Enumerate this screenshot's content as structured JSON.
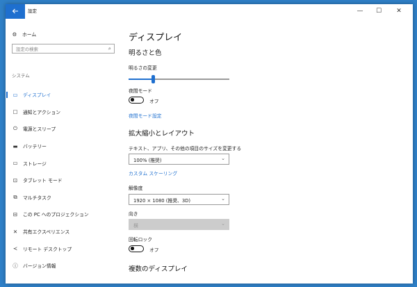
{
  "titlebar": {
    "title": "設定",
    "back_icon": "back-arrow-icon",
    "minimize": "—",
    "maximize": "☐",
    "close": "✕"
  },
  "sidebar": {
    "home": {
      "label": "ホーム",
      "icon": "gear-icon"
    },
    "search_placeholder": "設定の検索",
    "section": "システム",
    "items": [
      {
        "label": "ディスプレイ",
        "icon": "monitor-icon",
        "active": true
      },
      {
        "label": "通知とアクション",
        "icon": "notification-icon",
        "active": false
      },
      {
        "label": "電源とスリープ",
        "icon": "power-icon",
        "active": false
      },
      {
        "label": "バッテリー",
        "icon": "battery-icon",
        "active": false
      },
      {
        "label": "ストレージ",
        "icon": "storage-icon",
        "active": false
      },
      {
        "label": "タブレット モード",
        "icon": "tablet-icon",
        "active": false
      },
      {
        "label": "マルチタスク",
        "icon": "multitask-icon",
        "active": false
      },
      {
        "label": "この PC へのプロジェクション",
        "icon": "projection-icon",
        "active": false
      },
      {
        "label": "共有エクスペリエンス",
        "icon": "share-icon",
        "active": false
      },
      {
        "label": "リモート デスクトップ",
        "icon": "remote-icon",
        "active": false
      },
      {
        "label": "バージョン情報",
        "icon": "info-icon",
        "active": false
      }
    ]
  },
  "main": {
    "page_title": "ディスプレイ",
    "brightness_heading": "明るさと色",
    "brightness_label": "明るさの変更",
    "brightness_value": 0.24,
    "night_mode_label": "夜間モード",
    "night_mode_state": "オフ",
    "night_mode_settings_link": "夜間モード設定",
    "scale_heading": "拡大縮小とレイアウト",
    "scale_label": "テキスト、アプリ、その他の項目のサイズを変更する",
    "scale_value": "100% (推奨)",
    "custom_scaling_link": "カスタム スケーリング",
    "resolution_label": "解像度",
    "resolution_value": "1920 × 1080 (推奨、3D)",
    "orientation_label": "向き",
    "orientation_value": "横",
    "rotation_lock_label": "回転ロック",
    "rotation_lock_state": "オフ",
    "multi_display_heading": "複数のディスプレイ"
  },
  "colors": {
    "accent": "#1e6fcf",
    "desktop": "#2f80c8",
    "disabled": "#cccccc"
  }
}
